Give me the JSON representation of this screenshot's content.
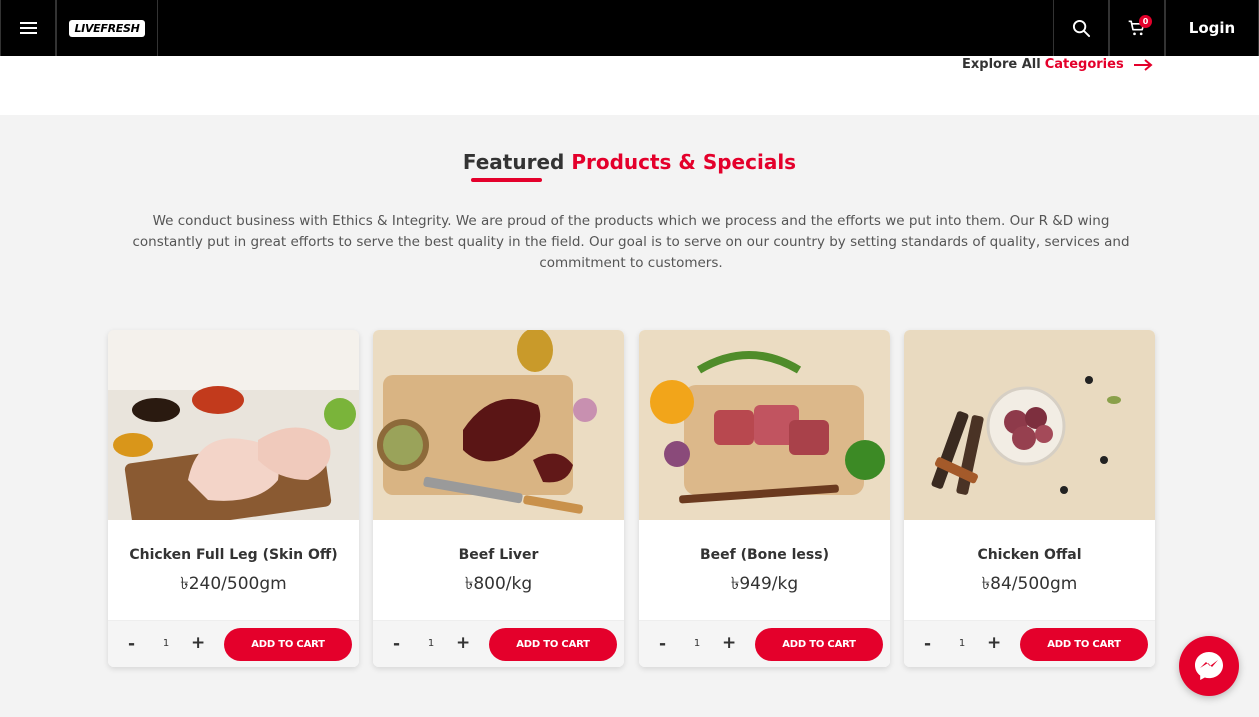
{
  "header": {
    "logo_text": "LIVEFRESH",
    "cart_count": "0",
    "login_label": "Login"
  },
  "explore": {
    "prefix": "Explore All",
    "highlight": "Categories"
  },
  "featured": {
    "title_dark": "Featured",
    "title_red": "Products & Specials",
    "description": "We conduct business with Ethics & Integrity. We are proud of the products which we process and the efforts we put into them. Our R &D wing constantly put in great efforts to serve the best quality in the field. Our goal is to serve on our country by setting standards of quality, services and commitment to customers."
  },
  "products": [
    {
      "name": "Chicken Full Leg (Skin Off)",
      "price": "৳240/500gm",
      "qty": "1",
      "add_label": "ADD TO CART"
    },
    {
      "name": "Beef Liver",
      "price": "৳800/kg",
      "qty": "1",
      "add_label": "ADD TO CART"
    },
    {
      "name": "Beef (Bone less)",
      "price": "৳949/kg",
      "qty": "1",
      "add_label": "ADD TO CART"
    },
    {
      "name": "Chicken Offal",
      "price": "৳84/500gm",
      "qty": "1",
      "add_label": "ADD TO CART"
    }
  ],
  "qty_controls": {
    "minus": "-",
    "plus": "+"
  },
  "colors": {
    "accent": "#e4002b",
    "topbar": "#000000",
    "background": "#f3f3f3"
  },
  "icons": [
    "menu-icon",
    "search-icon",
    "cart-icon",
    "arrow-right-icon",
    "messenger-icon"
  ]
}
